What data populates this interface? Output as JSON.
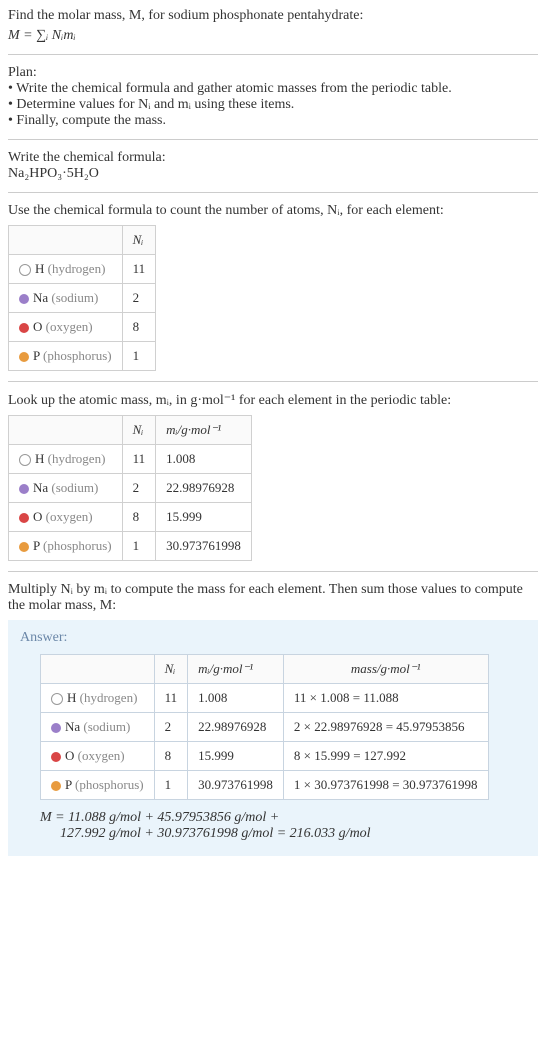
{
  "intro": {
    "line1": "Find the molar mass, M, for sodium phosphonate pentahydrate:",
    "formula": "M = ∑ᵢ Nᵢmᵢ"
  },
  "plan": {
    "title": "Plan:",
    "b1": "• Write the chemical formula and gather atomic masses from the periodic table.",
    "b2": "• Determine values for Nᵢ and mᵢ using these items.",
    "b3": "• Finally, compute the mass."
  },
  "step_formula": {
    "text": "Write the chemical formula:",
    "chem": "Na₂HPO₃·5H₂O"
  },
  "step_count": {
    "text": "Use the chemical formula to count the number of atoms, Nᵢ, for each element:",
    "header_n": "Nᵢ",
    "rows": [
      {
        "sym": "H",
        "name": "(hydrogen)",
        "n": "11"
      },
      {
        "sym": "Na",
        "name": "(sodium)",
        "n": "2"
      },
      {
        "sym": "O",
        "name": "(oxygen)",
        "n": "8"
      },
      {
        "sym": "P",
        "name": "(phosphorus)",
        "n": "1"
      }
    ]
  },
  "step_mass": {
    "text": "Look up the atomic mass, mᵢ, in g·mol⁻¹ for each element in the periodic table:",
    "header_n": "Nᵢ",
    "header_m": "mᵢ/g·mol⁻¹",
    "rows": [
      {
        "sym": "H",
        "name": "(hydrogen)",
        "n": "11",
        "m": "1.008"
      },
      {
        "sym": "Na",
        "name": "(sodium)",
        "n": "2",
        "m": "22.98976928"
      },
      {
        "sym": "O",
        "name": "(oxygen)",
        "n": "8",
        "m": "15.999"
      },
      {
        "sym": "P",
        "name": "(phosphorus)",
        "n": "1",
        "m": "30.973761998"
      }
    ]
  },
  "step_multiply": {
    "text": "Multiply Nᵢ by mᵢ to compute the mass for each element. Then sum those values to compute the molar mass, M:"
  },
  "answer": {
    "title": "Answer:",
    "header_n": "Nᵢ",
    "header_m": "mᵢ/g·mol⁻¹",
    "header_mass": "mass/g·mol⁻¹",
    "rows": [
      {
        "sym": "H",
        "name": "(hydrogen)",
        "n": "11",
        "m": "1.008",
        "mass": "11 × 1.008 = 11.088"
      },
      {
        "sym": "Na",
        "name": "(sodium)",
        "n": "2",
        "m": "22.98976928",
        "mass": "2 × 22.98976928 = 45.97953856"
      },
      {
        "sym": "O",
        "name": "(oxygen)",
        "n": "8",
        "m": "15.999",
        "mass": "8 × 15.999 = 127.992"
      },
      {
        "sym": "P",
        "name": "(phosphorus)",
        "n": "1",
        "m": "30.973761998",
        "mass": "1 × 30.973761998 = 30.973761998"
      }
    ],
    "final1": "M = 11.088 g/mol + 45.97953856 g/mol +",
    "final2": "127.992 g/mol + 30.973761998 g/mol = 216.033 g/mol"
  },
  "chart_data": {
    "type": "table",
    "title": "Molar mass of sodium phosphonate pentahydrate",
    "elements": [
      {
        "element": "H (hydrogen)",
        "N_i": 11,
        "m_i_g_per_mol": 1.008,
        "mass_g_per_mol": 11.088
      },
      {
        "element": "Na (sodium)",
        "N_i": 2,
        "m_i_g_per_mol": 22.98976928,
        "mass_g_per_mol": 45.97953856
      },
      {
        "element": "O (oxygen)",
        "N_i": 8,
        "m_i_g_per_mol": 15.999,
        "mass_g_per_mol": 127.992
      },
      {
        "element": "P (phosphorus)",
        "N_i": 1,
        "m_i_g_per_mol": 30.973761998,
        "mass_g_per_mol": 30.973761998
      }
    ],
    "molar_mass_g_per_mol": 216.033
  }
}
